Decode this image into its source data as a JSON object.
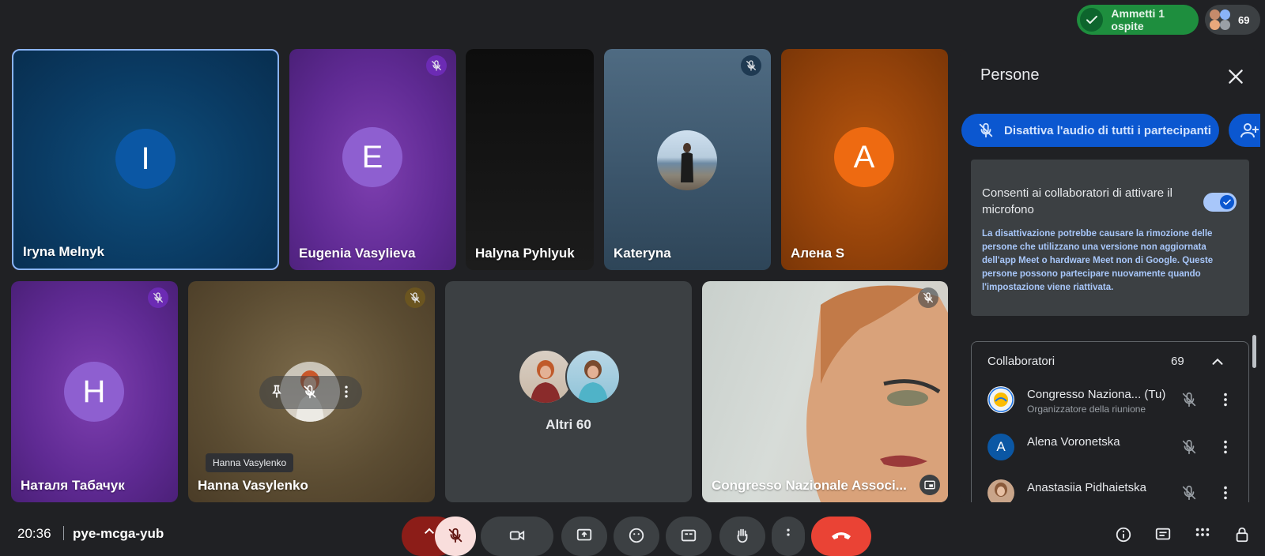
{
  "topbar": {
    "admit_label": "Ammetti 1 ospite",
    "participant_count": "69"
  },
  "tiles": {
    "iryna": {
      "initial": "I",
      "name": "Iryna Melnyk"
    },
    "eugenia": {
      "initial": "E",
      "name": "Eugenia Vasylieva"
    },
    "halyna": {
      "name": "Halyna Pyhlyuk"
    },
    "kateryna": {
      "name": "Kateryna"
    },
    "alena": {
      "initial": "A",
      "name": "Алена S"
    },
    "natalya": {
      "initial": "H",
      "name": "Наталя Табачук"
    },
    "hanna": {
      "name": "Hanna Vasylenko",
      "tooltip": "Hanna Vasylenko"
    },
    "others": {
      "label": "Altri 60"
    },
    "congresso": {
      "name": "Congresso Nazionale Associ..."
    }
  },
  "bottom": {
    "time": "20:36",
    "meeting_code": "pye-mcga-yub"
  },
  "panel": {
    "title": "Persone",
    "mute_all_label": "Disattiva l'audio di tutti i partecipanti",
    "settings": {
      "title": "Consenti ai collaboratori di attivare il microfono",
      "description": "La disattivazione potrebbe causare la rimozione delle persone che utilizzano una versione non aggiornata dell'app Meet o hardware Meet non di Google. Queste persone possono partecipare nuovamente quando l'impostazione viene riattivata.",
      "enabled": true
    },
    "section": {
      "title": "Collaboratori",
      "count": "69",
      "people": [
        {
          "name": "Congresso Naziona... (Tu)",
          "role": "Organizzatore della riunione"
        },
        {
          "initial": "A",
          "name": "Alena Voronetska"
        },
        {
          "name": "Anastasiia Pidhaietska"
        }
      ]
    }
  },
  "colors": {
    "background": "#202124",
    "accent": "#0b57d0",
    "end_call": "#ea4335",
    "admit_green": "#1e8e3e"
  }
}
